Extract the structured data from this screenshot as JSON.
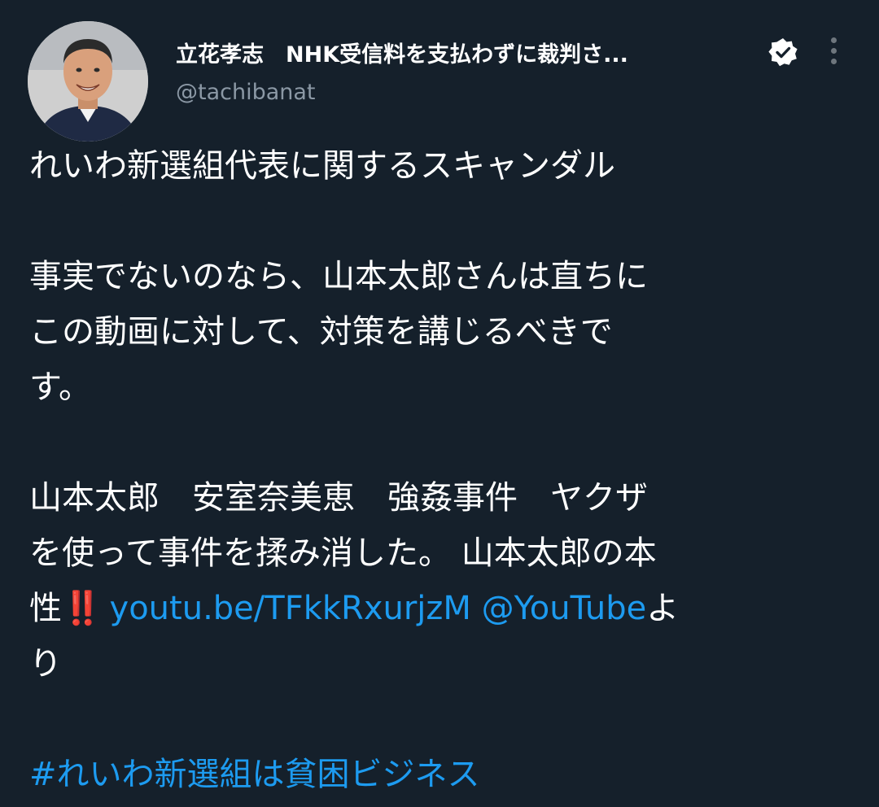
{
  "author": {
    "display_name": "立花孝志　NHK受信料を支払わずに裁判さ...",
    "handle": "@tachibanat",
    "verified": true
  },
  "tweet": {
    "line1": "れいわ新選組代表に関するスキャンダル",
    "line2": "事実でないのなら、山本太郎さんは直ちに",
    "line3": "この動画に対して、対策を講じるべきで",
    "line4": "す。",
    "line5": "山本太郎　安室奈美恵　強姦事件　ヤクザ",
    "line6": "を使って事件を揉み消した。 山本太郎の本",
    "line7_prefix": "性",
    "line7_emoji": "‼️",
    "link_url": "youtu.be/TFkkRxurjzM",
    "mention": "@YouTube",
    "line7_suffix": "よ",
    "line8": "り",
    "hashtag": "#れいわ新選組は貧困ビジネス"
  },
  "colors": {
    "background": "#15202b",
    "link": "#1d9bf0",
    "secondary_text": "#8b98a5",
    "emoji": "#e0245e"
  },
  "icons": {
    "verified": "verified-badge-icon",
    "more": "more-options-icon"
  }
}
